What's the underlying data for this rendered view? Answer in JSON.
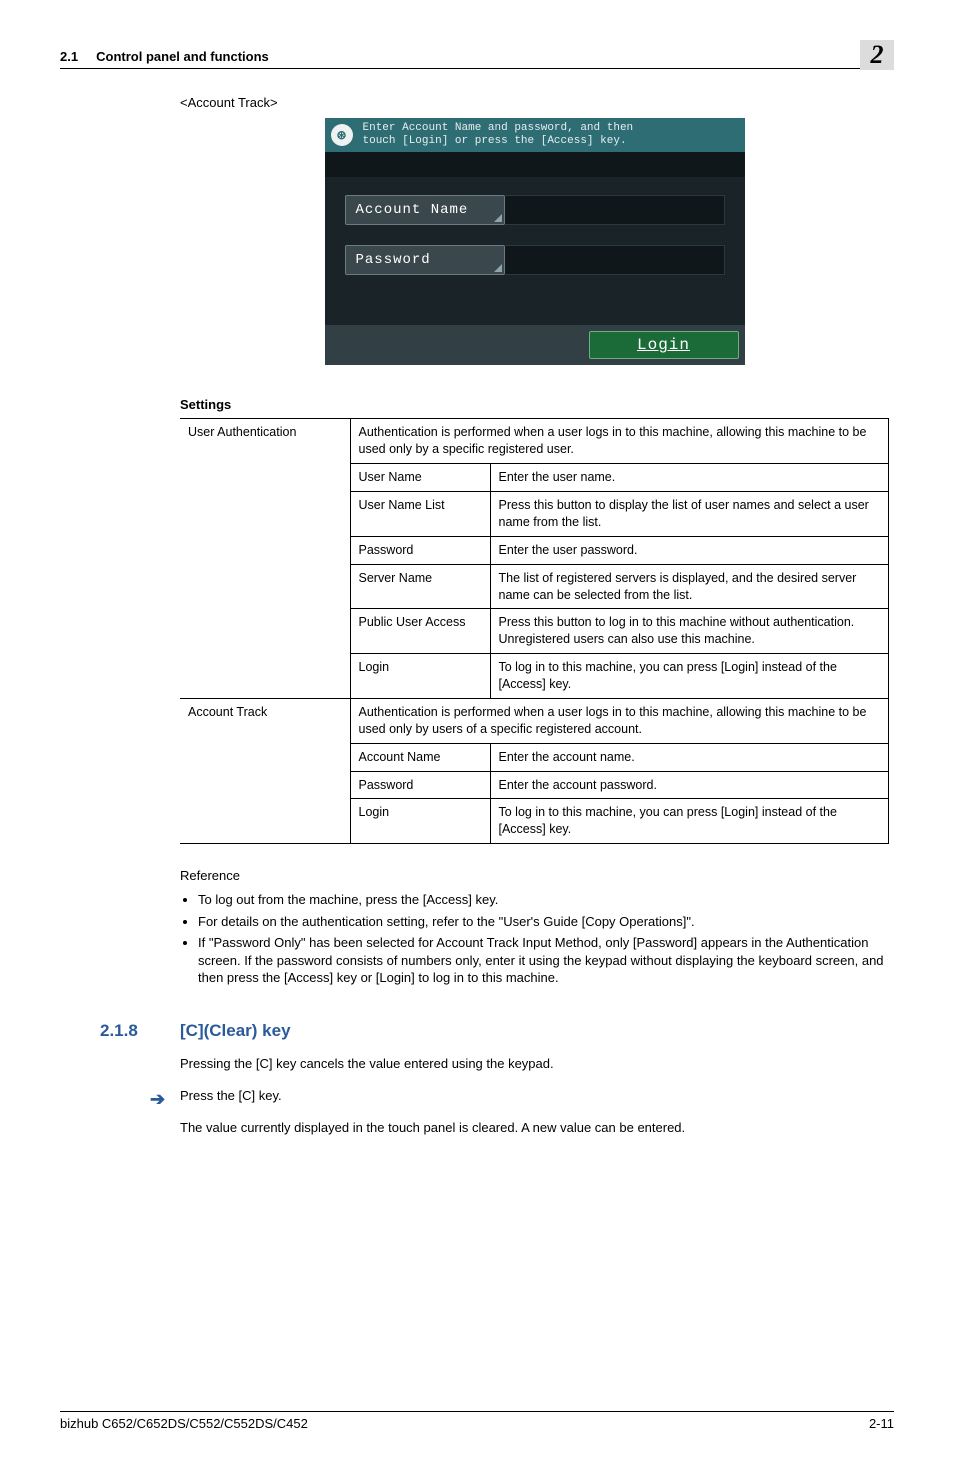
{
  "header": {
    "section_number": "2.1",
    "section_title": "Control panel and functions",
    "chapter_number": "2"
  },
  "caption": "<Account Track>",
  "touchpanel": {
    "instruction_l1": "Enter Account Name and password, and then",
    "instruction_l2": "touch [Login] or press the [Access] key.",
    "account_name_label": "Account Name",
    "password_label": "Password",
    "login_label": "Login"
  },
  "settings": {
    "heading": "Settings",
    "user_auth": {
      "label": "User Authentication",
      "desc": "Authentication is performed when a user logs in to this machine, allowing this machine to be used only by a specific registered user.",
      "rows": [
        {
          "k": "User Name",
          "v": "Enter the user name."
        },
        {
          "k": "User Name List",
          "v": "Press this button to display the list of user names and select a user name from the list."
        },
        {
          "k": "Password",
          "v": "Enter the user password."
        },
        {
          "k": "Server Name",
          "v": "The list of registered servers is displayed, and the desired server name can be selected from the list."
        },
        {
          "k": "Public User Access",
          "v": "Press this button to log in to this machine without authentication. Unregistered users can also use this machine."
        },
        {
          "k": "Login",
          "v": "To log in to this machine, you can press [Login] instead of the [Access] key."
        }
      ]
    },
    "account_track": {
      "label": "Account Track",
      "desc": "Authentication is performed when a user logs in to this machine, allowing this machine to be used only by users of a specific registered account.",
      "rows": [
        {
          "k": "Account Name",
          "v": "Enter the account name."
        },
        {
          "k": "Password",
          "v": "Enter the account password."
        },
        {
          "k": "Login",
          "v": "To log in to this machine, you can press [Login] instead of the [Access] key."
        }
      ]
    }
  },
  "reference": {
    "title": "Reference",
    "items": [
      "To log out from the machine, press the [Access] key.",
      "For details on the authentication setting, refer to the \"User's Guide [Copy Operations]\".",
      "If \"Password Only\" has been selected for Account Track Input Method, only [Password] appears in the Authentication screen. If the password consists of numbers only, enter it using the keypad without displaying the keyboard screen, and then press the [Access] key or [Login] to log in to this machine."
    ]
  },
  "sec218": {
    "number": "2.1.8",
    "title": "[C](Clear) key",
    "p1": "Pressing the [C] key cancels the value entered using the keypad.",
    "step": "Press the [C] key.",
    "p2": "The value currently displayed in the touch panel is cleared. A new value can be entered."
  },
  "footer": {
    "model": "bizhub C652/C652DS/C552/C552DS/C452",
    "page": "2-11"
  }
}
